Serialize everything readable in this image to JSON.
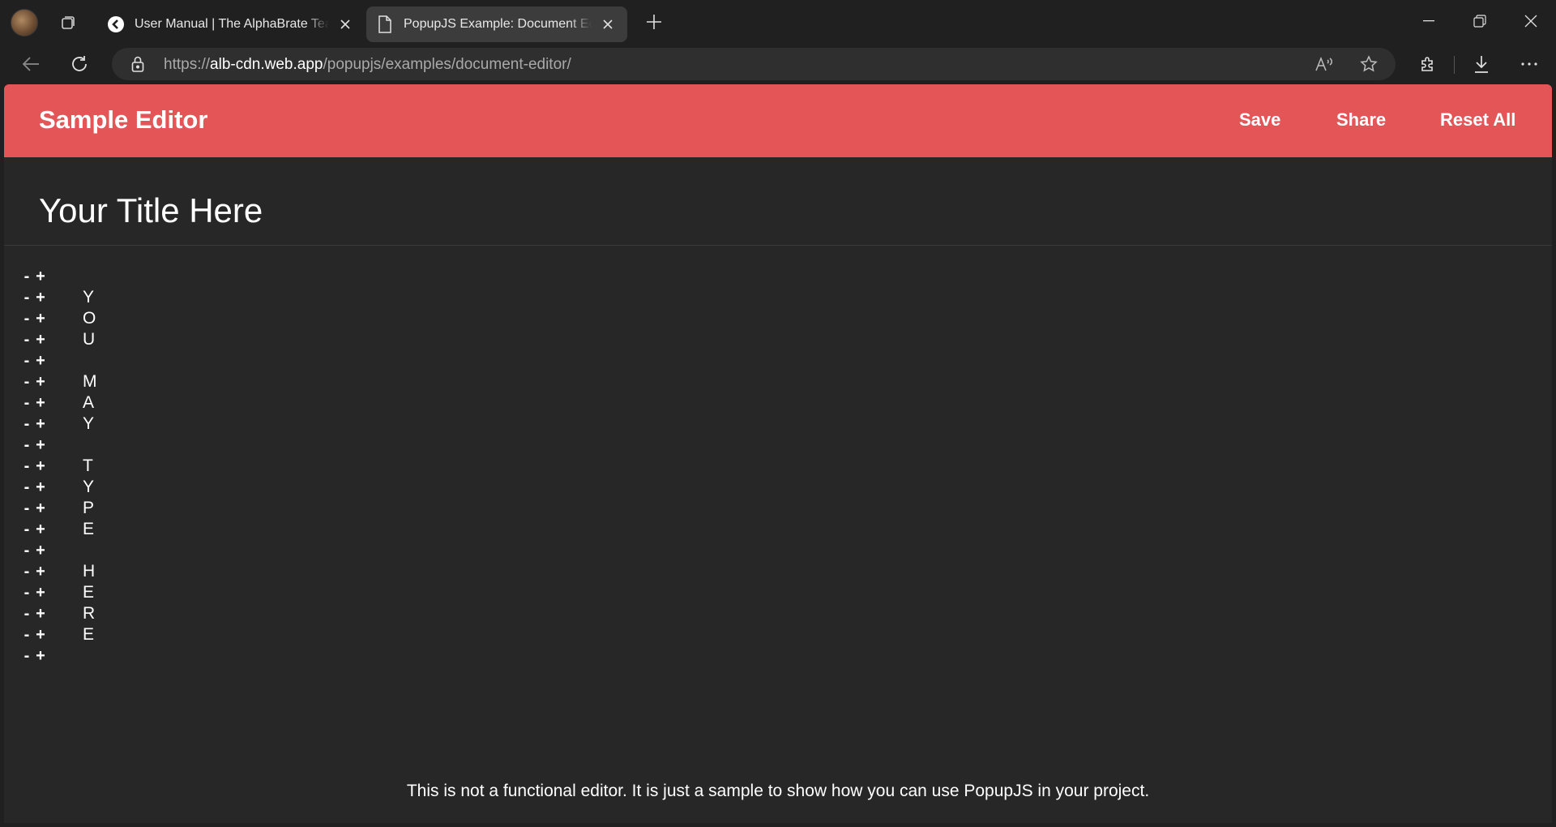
{
  "browser": {
    "tabs": [
      {
        "title": "User Manual | The AlphaBrate Team",
        "active": false
      },
      {
        "title": "PopupJS Example: Document Editor",
        "active": true
      }
    ],
    "url_scheme": "https://",
    "url_host": "alb-cdn.web.app",
    "url_path": "/popupjs/examples/document-editor/"
  },
  "app": {
    "title": "Sample Editor",
    "actions": {
      "save": "Save",
      "share": "Share",
      "reset": "Reset All"
    },
    "accent_color": "#e35557"
  },
  "document": {
    "title": "Your Title Here",
    "line_controls": {
      "minus": "-",
      "plus": "+"
    },
    "lines": [
      "",
      "Y",
      "O",
      "U",
      "",
      "M",
      "A",
      "Y",
      "",
      "T",
      "Y",
      "P",
      "E",
      "",
      "H",
      "E",
      "R",
      "E",
      ""
    ]
  },
  "footer": {
    "note": "This is not a functional editor. It is just a sample to show how you can use PopupJS in your project."
  }
}
